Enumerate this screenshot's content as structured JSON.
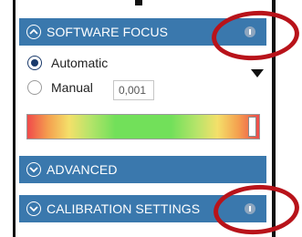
{
  "software_focus": {
    "title": "SOFTWARE FOCUS",
    "mode_options": [
      {
        "label": "Automatic",
        "selected": true
      },
      {
        "label": "Manual",
        "selected": false
      }
    ],
    "manual_value": "0,001",
    "focus_level": 0.95
  },
  "advanced": {
    "title": "ADVANCED"
  },
  "calibration": {
    "title": "CALIBRATION SETTINGS"
  },
  "icons": {
    "collapse": "chevron-up-icon",
    "expand": "chevron-down-icon",
    "info": "info-icon",
    "dropdown": "triangle-down-icon"
  },
  "colors": {
    "header_bg": "#3a78ad",
    "highlight_ring": "#b8131a",
    "radio_selected": "#1a3a6b"
  }
}
